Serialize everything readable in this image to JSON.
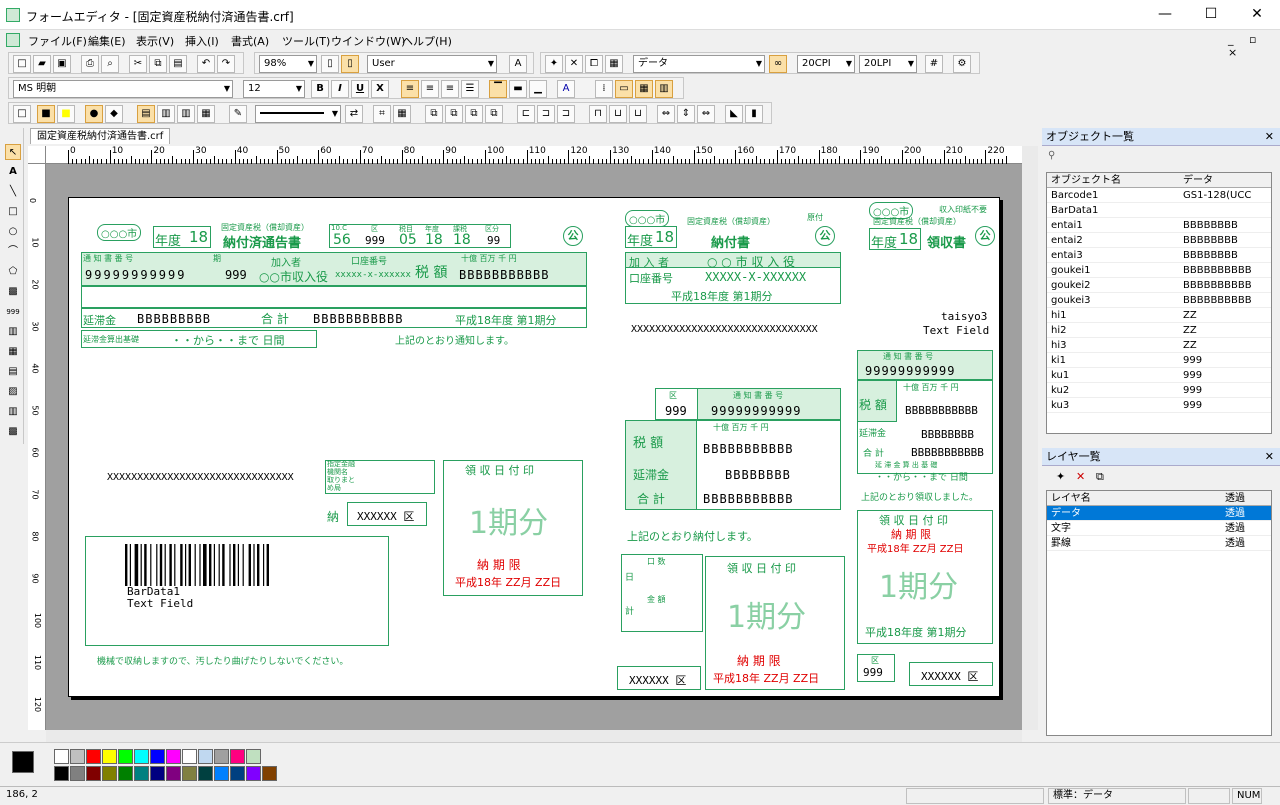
{
  "window": {
    "title": "フォームエディタ - [固定資産税納付済通告書.crf]",
    "min": "—",
    "max": "☐",
    "close": "✕"
  },
  "menu": [
    "ファイル(F)",
    "編集(E)",
    "表示(V)",
    "挿入(I)",
    "書式(A)",
    "ツール(T)",
    "ウインドウ(W)",
    "ヘルプ(H)"
  ],
  "toolbar": {
    "zoom": "98%",
    "user": "User",
    "layer_select": "データ",
    "cpi": "20CPI",
    "lpi": "20LPI",
    "font": "MS 明朝",
    "font_size": "12",
    "bold": "B",
    "italic": "I",
    "underline": "U",
    "strike": "X"
  },
  "document_tab": "固定資産税納付済通告書.crf",
  "ruler": {
    "h": [
      "0",
      "10",
      "20",
      "30",
      "40",
      "50",
      "60",
      "70",
      "80",
      "90",
      "100",
      "110",
      "120",
      "130",
      "140",
      "150",
      "160",
      "170",
      "180",
      "190",
      "200",
      "210",
      "220"
    ],
    "v": [
      "0",
      "10",
      "20",
      "30",
      "40",
      "50",
      "60",
      "70",
      "80",
      "90",
      "100",
      "110",
      "120"
    ]
  },
  "form": {
    "city": "○○○市",
    "nendo": "年度",
    "nendo_val": "18",
    "subtitle": "固定資産税（償却資産）",
    "title_a": "納付済通告書",
    "h_10c": "10.C",
    "h_ku": "区",
    "h_zeimoku": "税目",
    "h_nendo": "年度",
    "h_kika": "課税",
    "h_kubun": "区分",
    "v_56": "56",
    "v_999": "999",
    "v_05": "05",
    "v_18a": "18",
    "v_18b": "18",
    "v_99": "99",
    "kou": "公",
    "tsuchi_label": "通 知 書 番 号",
    "tsuchi_val": "99999999999",
    "ki_label": "期",
    "ki_val": "999",
    "kanyusha": "加入者",
    "kanyusha_val": "○○市収入役",
    "koza": "口座番号",
    "koza_val": "xxxxx-x-xxxxxx",
    "zeigaku": "税 額",
    "digits_a": "十億 百万 千 円",
    "bbb1": "BBBBBBBBBBB",
    "entai": "延滞金",
    "bbb2": "BBBBBBBBB",
    "gokei": "合 計",
    "bbb3": "BBBBBBBBBBB",
    "period_a": "平成18年度 第1期分",
    "entai_kiso": "延滞金算出基礎",
    "kara_made": "・・から・・まで 日間",
    "notice": "上記のとおり通知します。",
    "xrow1": "XXXXXXXXXXXXXXXXXXXXXXXXXXXXXXX",
    "shiharai": [
      "指定金融",
      "機関名",
      "取りまと",
      "め局"
    ],
    "nou": "納",
    "xbox": "XXXXXX 区",
    "ryoshu_date": "領 収 日 付 印",
    "kibun": "1期分",
    "noukigen": "納 期 限",
    "kigen_val": "平成18年 ZZ月 ZZ日",
    "bardata": "BarData1",
    "textfield": "Text Field",
    "machine_note": "機械で収納しますので、汚したり曲げたりしないでください。",
    "title_b": "納付書",
    "gensatsu": "原付",
    "kanyusha_b": "加 入 者",
    "shuunyu": "○ ○ 市 収 入 役",
    "koza_b": "口座番号",
    "koza_b_val": "XXXXX-X-XXXXXX",
    "period_b": "平成18年度 第1期分",
    "xrow2": "XXXXXXXXXXXXXXXXXXXXXXXXXXXXXXX",
    "taisyo": "taisyo3",
    "taisyo_tf": "Text Field",
    "ku_b": "区",
    "ku_b_val": "999",
    "tsuchi_b": "通 知 書 番 号",
    "tsuchi_b_val": "99999999999",
    "zeigaku_b": "税 額",
    "digits_b": "十億 百万 千 円",
    "bbb_b1": "BBBBBBBBBBB",
    "entai_b": "延滞金",
    "bbb_b2": "BBBBBBBB",
    "gokei_b": "合 計",
    "bbb_b3": "BBBBBBBBBBB",
    "noufu_notice": "上記のとおり納付します。",
    "nichi": "日",
    "kei": "計",
    "kosu": "口 数",
    "kingaku": "金 額",
    "title_c": "領収書",
    "inshi": "収入印紙不要",
    "tsuchi_c": "通 知 書 番 号",
    "tsuchi_c_val": "99999999999",
    "zeigaku_c": "税 額",
    "digits_c": "十億 百万 千 円",
    "bbb_c1": "BBBBBBBBBBB",
    "entai_c": "延滞金",
    "bbb_c2": "BBBBBBBB",
    "gokei_c": "合 計",
    "bbb_c3": "BBBBBBBBBBB",
    "kiso_c": "延 滞 金 算 出 基 礎",
    "kara_c": "・・から・・まで 日間",
    "ryoshu_notice": "上記のとおり領収しました。",
    "period_c": "平成18年度 第1期分",
    "ku_c": "区",
    "ku_c_val": "999"
  },
  "objects_panel": {
    "title": "オブジェクト一覧",
    "col_name": "オブジェクト名",
    "col_data": "データ",
    "rows": [
      [
        "Barcode1",
        "GS1-128(UCC"
      ],
      [
        "BarData1",
        ""
      ],
      [
        "entai1",
        "BBBBBBBB"
      ],
      [
        "entai2",
        "BBBBBBBB"
      ],
      [
        "entai3",
        "BBBBBBBB"
      ],
      [
        "goukei1",
        "BBBBBBBBBB"
      ],
      [
        "goukei2",
        "BBBBBBBBBB"
      ],
      [
        "goukei3",
        "BBBBBBBBBB"
      ],
      [
        "hi1",
        "ZZ"
      ],
      [
        "hi2",
        "ZZ"
      ],
      [
        "hi3",
        "ZZ"
      ],
      [
        "ki1",
        "999"
      ],
      [
        "ku1",
        "999"
      ],
      [
        "ku2",
        "999"
      ],
      [
        "ku3",
        "999"
      ]
    ]
  },
  "layers_panel": {
    "title": "レイヤ一覧",
    "col_name": "レイヤ名",
    "col_mode": "透過",
    "rows": [
      [
        "データ",
        "透過"
      ],
      [
        "文字",
        "透過"
      ],
      [
        "罫線",
        "透過"
      ]
    ]
  },
  "palette": {
    "colors": [
      "#ffffff",
      "#c0c0c0",
      "#ff0000",
      "#ffff00",
      "#00ff00",
      "#00ffff",
      "#0000ff",
      "#ff00ff",
      "#ffffff",
      "#c0d8f0",
      "#a0a0a0",
      "#ff0080",
      "#c0e0c0",
      "#000000",
      "#808080",
      "#800000",
      "#808000",
      "#008000",
      "#008080",
      "#000080",
      "#800080",
      "#808040",
      "#004040",
      "#0080ff",
      "#004080",
      "#8000ff",
      "#804000"
    ]
  },
  "status": {
    "coords": "186, 2",
    "layer": "標準：データ",
    "num": "NUM"
  }
}
